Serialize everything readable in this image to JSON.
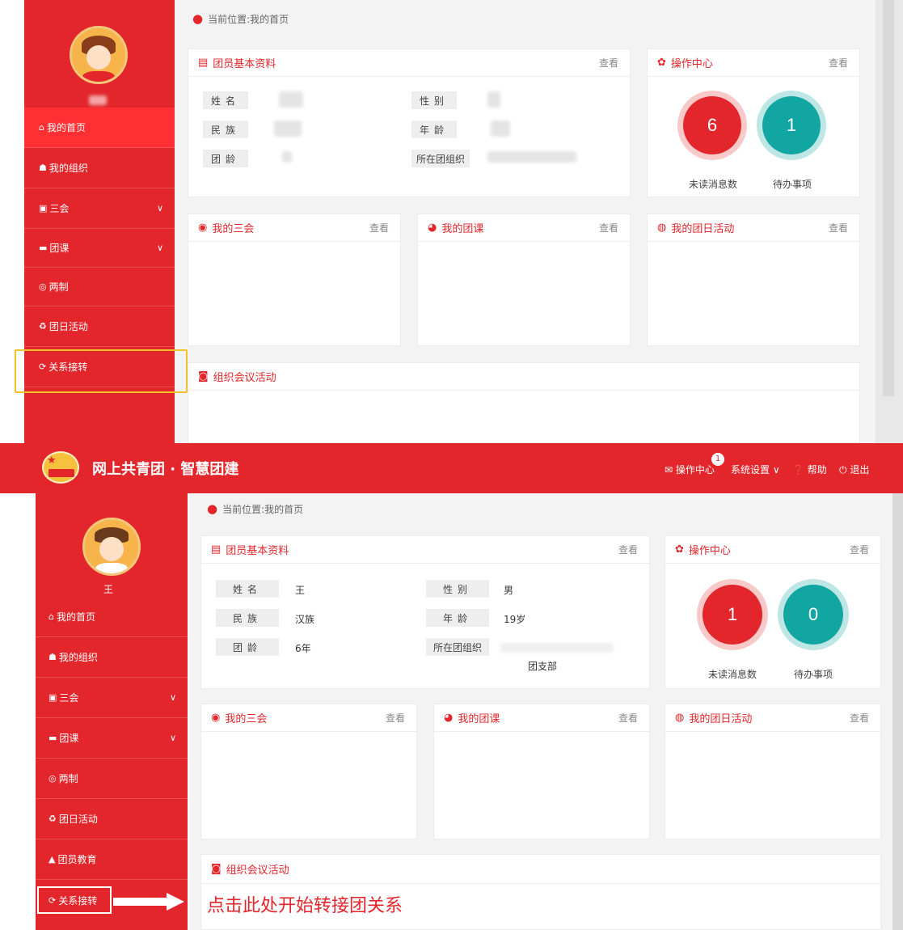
{
  "top": {
    "breadcrumb": "当前位置:我的首页",
    "profile_name": "",
    "nav": [
      {
        "label": "我的首页",
        "icon": "home-icon",
        "glyph": "⌂"
      },
      {
        "label": "我的组织",
        "icon": "org-icon",
        "glyph": "☗"
      },
      {
        "label": "三会",
        "icon": "edit-icon",
        "glyph": "▣"
      },
      {
        "label": "团课",
        "icon": "folder-icon",
        "glyph": "▬"
      },
      {
        "label": "两制",
        "icon": "clock-icon",
        "glyph": "◎"
      },
      {
        "label": "团日活动",
        "icon": "recycle-icon",
        "glyph": "♻"
      },
      {
        "label": "关系接转",
        "icon": "refresh-icon",
        "glyph": "⟳"
      }
    ],
    "profile_card": {
      "title": "团员基本资料",
      "view": "查看",
      "fields": [
        {
          "label": "姓名",
          "value": ""
        },
        {
          "label": "性别",
          "value": ""
        },
        {
          "label": "民族",
          "value": ""
        },
        {
          "label": "年龄",
          "value": ""
        },
        {
          "label": "团龄",
          "value": ""
        },
        {
          "label": "所在团组织",
          "value": ""
        }
      ]
    },
    "ops": {
      "title": "操作中心",
      "view": "查看",
      "unread": "6",
      "todo": "1",
      "unread_label": "未读消息数",
      "todo_label": "待办事项"
    },
    "cards": [
      {
        "title": "我的三会",
        "view": "查看"
      },
      {
        "title": "我的团课",
        "view": "查看"
      },
      {
        "title": "我的团日活动",
        "view": "查看"
      }
    ],
    "meeting": {
      "title": "组织会议活动"
    }
  },
  "bottom": {
    "app_title": "网上共青团 · 智慧团建",
    "header_links": {
      "ops": "操作中心",
      "ops_badge": "1",
      "settings": "系统设置",
      "help": "帮助",
      "logout": "退出"
    },
    "breadcrumb": "当前位置:我的首页",
    "profile_name": "王",
    "nav": [
      {
        "label": "我的首页",
        "icon": "home-icon",
        "glyph": "⌂"
      },
      {
        "label": "我的组织",
        "icon": "org-icon",
        "glyph": "☗"
      },
      {
        "label": "三会",
        "icon": "edit-icon",
        "glyph": "▣"
      },
      {
        "label": "团课",
        "icon": "folder-icon",
        "glyph": "▬"
      },
      {
        "label": "两制",
        "icon": "clock-icon",
        "glyph": "◎"
      },
      {
        "label": "团日活动",
        "icon": "recycle-icon",
        "glyph": "♻"
      },
      {
        "label": "团员教育",
        "icon": "graduation-icon",
        "glyph": "▲"
      },
      {
        "label": "关系接转",
        "icon": "refresh-icon",
        "glyph": "⟳"
      }
    ],
    "profile_card": {
      "title": "团员基本资料",
      "view": "查看",
      "fields": [
        {
          "label": "姓名",
          "value": "王"
        },
        {
          "label": "性别",
          "value": "男"
        },
        {
          "label": "民族",
          "value": "汉族"
        },
        {
          "label": "年龄",
          "value": "19岁"
        },
        {
          "label": "团龄",
          "value": "6年"
        },
        {
          "label": "所在团组织",
          "value": "团支部"
        }
      ]
    },
    "ops": {
      "title": "操作中心",
      "view": "查看",
      "unread": "1",
      "todo": "0",
      "unread_label": "未读消息数",
      "todo_label": "待办事项"
    },
    "cards": [
      {
        "title": "我的三会",
        "view": "查看"
      },
      {
        "title": "我的团课",
        "view": "查看"
      },
      {
        "title": "我的团日活动",
        "view": "查看"
      }
    ],
    "meeting": {
      "title": "组织会议活动"
    },
    "cta": "点击此处开始转接团关系"
  },
  "colors": {
    "brand_red": "#e2262b",
    "teal": "#12a6a2",
    "highlight": "#f2c12e"
  }
}
